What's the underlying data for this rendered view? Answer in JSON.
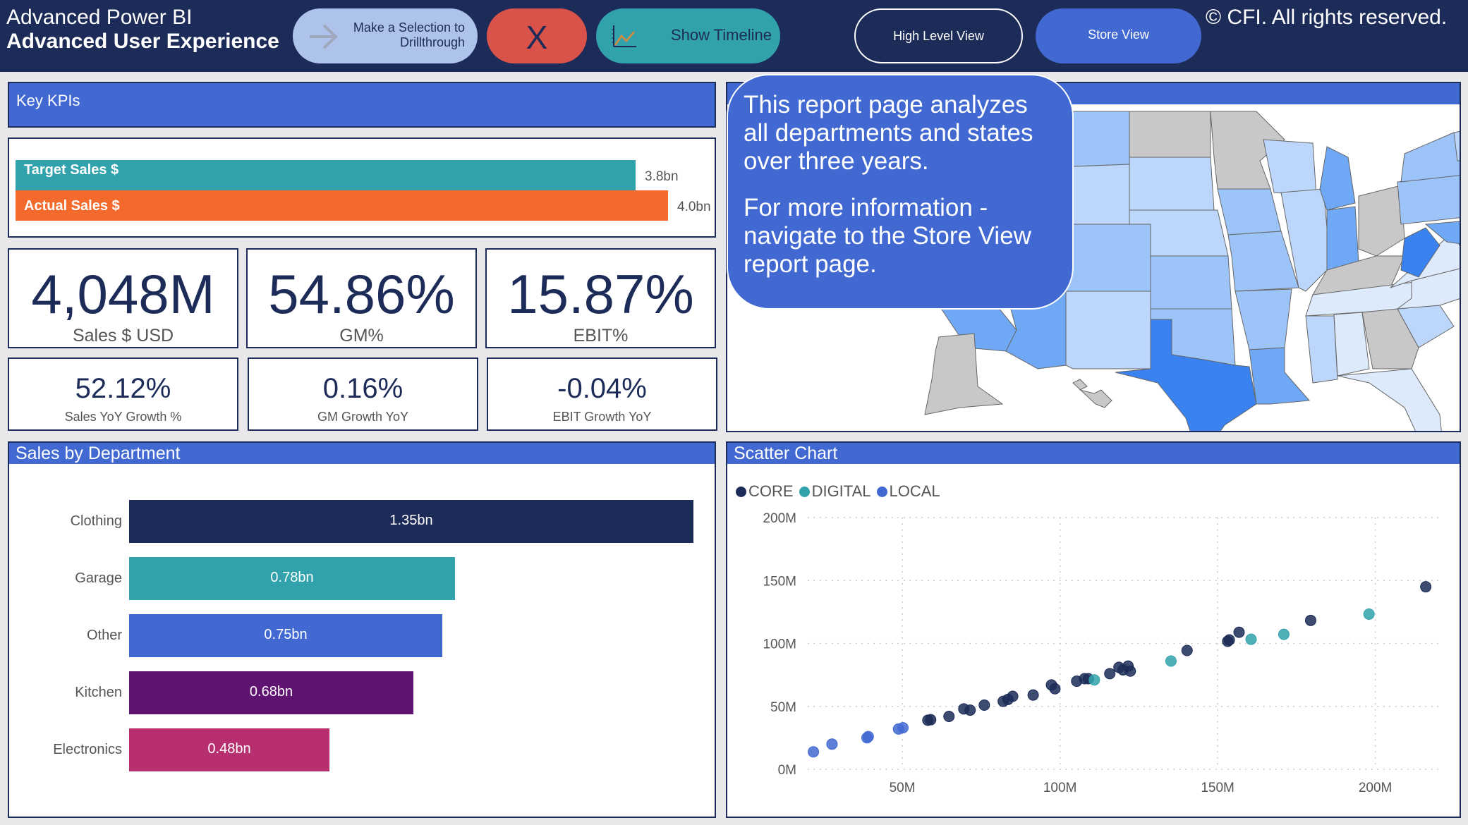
{
  "header": {
    "title_line1": "Advanced Power BI",
    "title_line2": "Advanced User Experience",
    "drillthrough_button": "Make a Selection to Drillthrough",
    "drillthrough_line1": "Make a Selection to",
    "drillthrough_line2": "Drillthrough",
    "close_button": "X",
    "timeline_button": "Show Timeline",
    "high_level_button": "High Level View",
    "store_view_button": "Store View",
    "copyright": "© CFI. All rights reserved."
  },
  "kpi_section": {
    "title": "Key KPIs",
    "target_vs_actual": [
      {
        "label": "Target Sales $",
        "value": 3.8,
        "display": "3.8bn",
        "color": "#31a2ac"
      },
      {
        "label": "Actual Sales $",
        "value": 4.0,
        "display": "4.0bn",
        "color": "#f46a2d"
      }
    ],
    "big_cards": [
      {
        "value": "4,048M",
        "label": "Sales $ USD"
      },
      {
        "value": "54.86%",
        "label": "GM%"
      },
      {
        "value": "15.87%",
        "label": "EBIT%"
      }
    ],
    "small_cards": [
      {
        "value": "52.12%",
        "label": "Sales YoY Growth %"
      },
      {
        "value": "0.16%",
        "label": "GM Growth YoY"
      },
      {
        "value": "-0.04%",
        "label": "EBIT Growth YoY"
      }
    ]
  },
  "map_section": {
    "callout_p1": "This report page analyzes all departments and states over three years.",
    "callout_p2": "For more information - navigate to the Store View report page.",
    "colors": {
      "no_data": "#c8c8c8",
      "lightest": "#ddeafc",
      "light": "#bcd7fb",
      "medium": "#9cc4f8",
      "dark": "#6fa8f5",
      "darkest": "#3a82f0"
    }
  },
  "department_section": {
    "title": "Sales by Department"
  },
  "scatter_section": {
    "title": "Scatter Chart"
  },
  "chart_data": [
    {
      "type": "bar",
      "orientation": "horizontal",
      "title": "Sales by Department",
      "categories": [
        "Clothing",
        "Garage",
        "Other",
        "Kitchen",
        "Electronics"
      ],
      "values": [
        1.35,
        0.78,
        0.75,
        0.68,
        0.48
      ],
      "value_labels": [
        "1.35bn",
        "0.78bn",
        "0.75bn",
        "0.68bn",
        "0.48bn"
      ],
      "colors": [
        "#1c2b57",
        "#31a2ac",
        "#4169d1",
        "#5e1470",
        "#b72f6e"
      ],
      "unit": "bn",
      "xlabel": "",
      "ylabel": ""
    },
    {
      "type": "scatter",
      "title": "Scatter Chart",
      "xlabel": "",
      "ylabel": "",
      "xlim": [
        20,
        220
      ],
      "ylim": [
        0,
        200
      ],
      "x_ticks": [
        "50M",
        "100M",
        "150M",
        "200M"
      ],
      "x_tick_values": [
        50,
        100,
        150,
        200
      ],
      "y_ticks": [
        "0M",
        "50M",
        "100M",
        "150M",
        "200M"
      ],
      "y_tick_values": [
        0,
        50,
        100,
        150,
        200
      ],
      "grid": true,
      "legend_position": "top-left",
      "series": [
        {
          "name": "CORE",
          "color": "#1c2b57",
          "points": [
            [
              58.1,
              39
            ],
            [
              59,
              39.4
            ],
            [
              64.8,
              42
            ],
            [
              69.5,
              48
            ],
            [
              71.5,
              47
            ],
            [
              76,
              51
            ],
            [
              82,
              54
            ],
            [
              83.5,
              55.5
            ],
            [
              85,
              58
            ],
            [
              91.5,
              59
            ],
            [
              97.3,
              67
            ],
            [
              98.4,
              64
            ],
            [
              105.3,
              70
            ],
            [
              107.8,
              72
            ],
            [
              109,
              72
            ],
            [
              115.8,
              76
            ],
            [
              118.7,
              81
            ],
            [
              120,
              79
            ],
            [
              121.6,
              82
            ],
            [
              122.3,
              78
            ],
            [
              140.3,
              94.4
            ],
            [
              153.2,
              101.7
            ],
            [
              153.7,
              102.8
            ],
            [
              156.8,
              108.9
            ],
            [
              179.5,
              118.3
            ],
            [
              216,
              145
            ]
          ]
        },
        {
          "name": "DIGITAL",
          "color": "#31a2ac",
          "points": [
            [
              110.9,
              71
            ],
            [
              135.2,
              86
            ],
            [
              160.6,
              103.3
            ],
            [
              171,
              107.2
            ],
            [
              198,
              123.3
            ]
          ]
        },
        {
          "name": "LOCAL",
          "color": "#4169d1",
          "points": [
            [
              21.8,
              13.9
            ],
            [
              27.7,
              20
            ],
            [
              38.8,
              25
            ],
            [
              39.2,
              26
            ],
            [
              48.8,
              32
            ],
            [
              50.2,
              33
            ]
          ]
        }
      ]
    }
  ]
}
